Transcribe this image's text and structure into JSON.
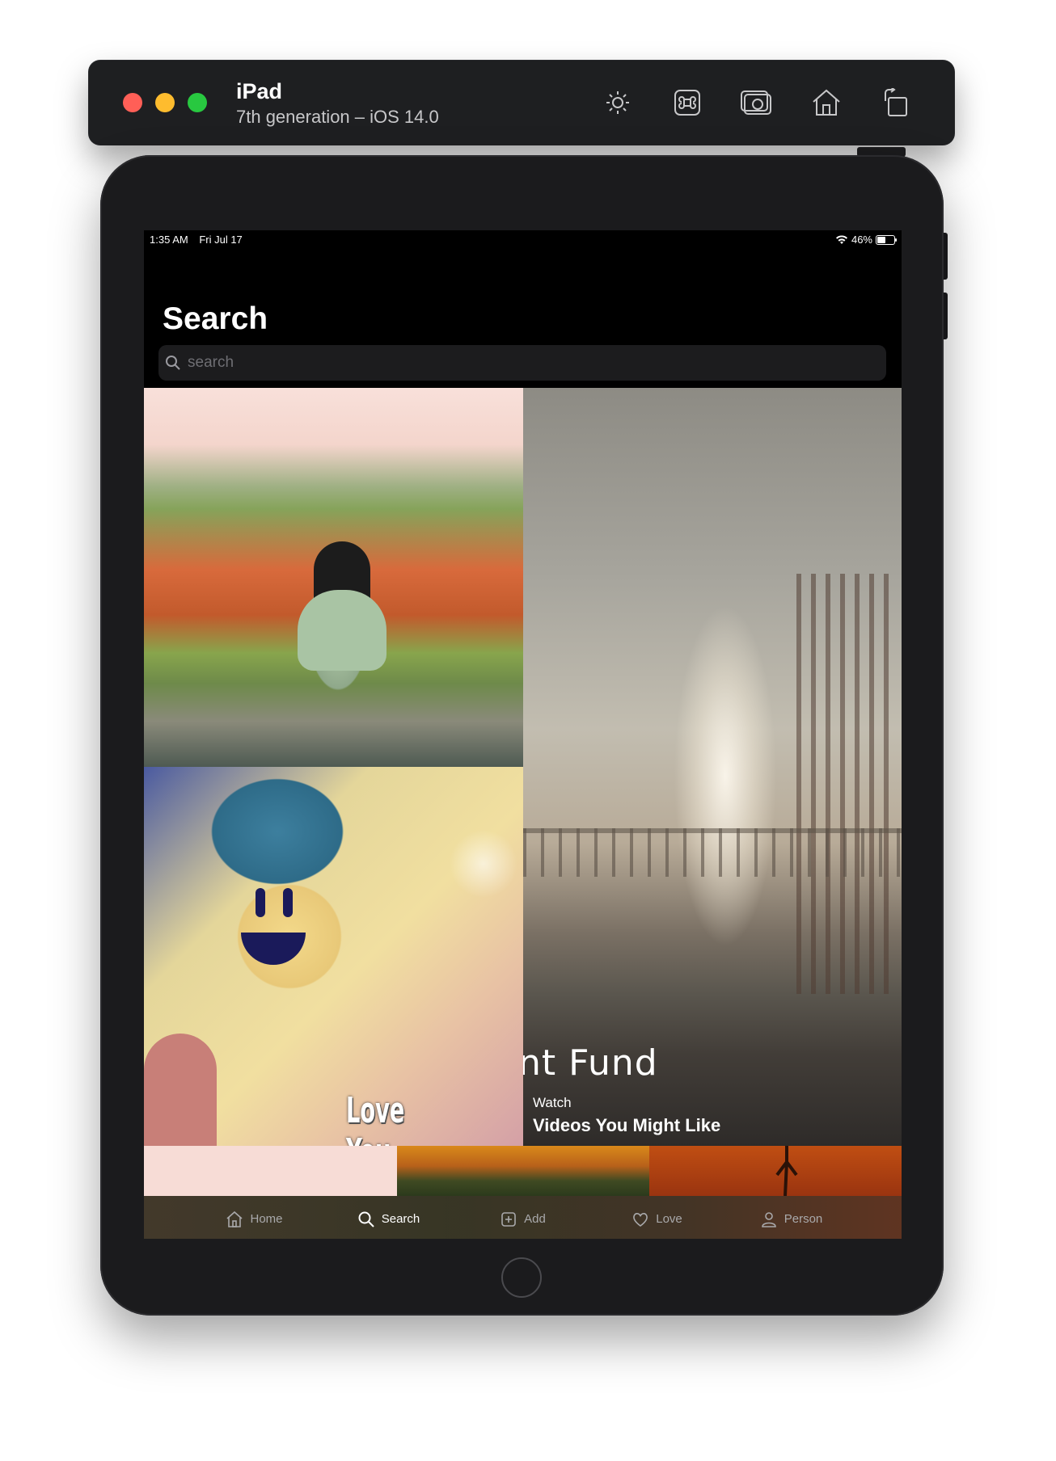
{
  "simulator": {
    "device_name": "iPad",
    "device_info": "7th generation – iOS 14.0",
    "traffic_lights": [
      "#ff5f57",
      "#febc2e",
      "#28c840"
    ],
    "tools": [
      "brightness-icon",
      "command-icon",
      "screenshot-icon",
      "home-icon",
      "rotate-icon"
    ]
  },
  "status_bar": {
    "time": "1:35 AM",
    "date": "Fri Jul 17",
    "battery": "46%",
    "battery_level": 0.46
  },
  "screen": {
    "title": "Search",
    "search": {
      "placeholder": "search",
      "value": ""
    }
  },
  "tiles": {
    "large_video": {
      "overlay_text": "nt Fund",
      "watch_label": "Watch",
      "videos_label": "Videos You Might Like"
    },
    "friends_text": "Love You Friends"
  },
  "tab_bar": {
    "items": [
      {
        "label": "Home",
        "icon": "home-icon",
        "active": false
      },
      {
        "label": "Search",
        "icon": "search-icon",
        "active": true
      },
      {
        "label": "Add",
        "icon": "add-square-icon",
        "active": false
      },
      {
        "label": "Love",
        "icon": "heart-icon",
        "active": false
      },
      {
        "label": "Person",
        "icon": "person-icon",
        "active": false
      }
    ]
  }
}
